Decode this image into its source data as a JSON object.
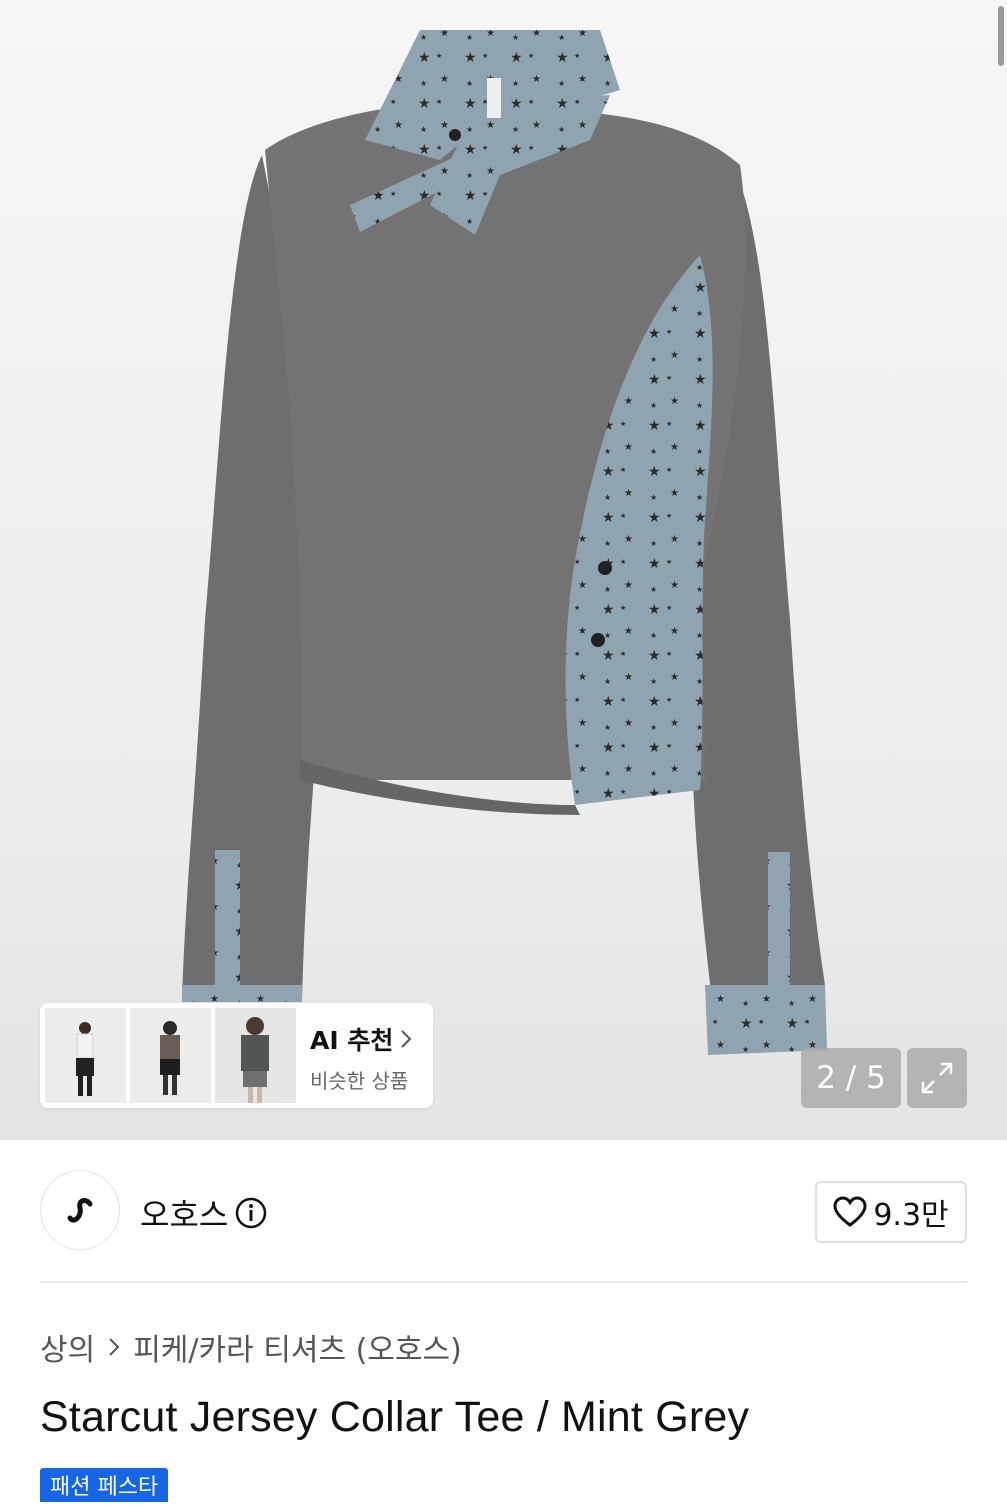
{
  "gallery": {
    "counter": "2 / 5",
    "expand_icon": "expand-icon"
  },
  "ai_recommend": {
    "title": "AI 추천",
    "subtitle": "비슷한 상품"
  },
  "brand": {
    "name": "오호스",
    "like_count": "9.3만"
  },
  "breadcrumb": {
    "category": "상의",
    "subcategory": "피케/카라 티셔츠 (오호스)"
  },
  "product": {
    "title": "Starcut Jersey Collar Tee / Mint Grey",
    "badge": "패션 페스타"
  },
  "colors": {
    "badge_blue": "#1565e6",
    "shirt_grey": "#6e6e6e",
    "star_panel": "#8fa3b0"
  }
}
